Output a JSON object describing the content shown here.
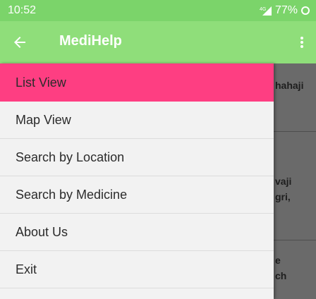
{
  "status_bar": {
    "time": "10:52",
    "battery": "77%"
  },
  "app_bar": {
    "title": "MediHelp",
    "back_icon": "arrow-left-icon",
    "menu_icon": "more-vertical-icon"
  },
  "drawer": {
    "items": [
      {
        "label": "List View",
        "active": true
      },
      {
        "label": "Map View",
        "active": false
      },
      {
        "label": "Search by Location",
        "active": false
      },
      {
        "label": "Search by Medicine",
        "active": false
      },
      {
        "label": "About Us",
        "active": false
      },
      {
        "label": "Exit",
        "active": false
      }
    ]
  },
  "background_list": {
    "fragments": [
      "hahaji",
      "vaji",
      "gri,",
      "e",
      "ch"
    ]
  },
  "colors": {
    "status_bar": "#7bd46a",
    "app_bar": "#8fde7a",
    "active_item": "#fe3e82",
    "drawer_bg": "#f2f2f2",
    "scrim": "#6a6a6a"
  }
}
